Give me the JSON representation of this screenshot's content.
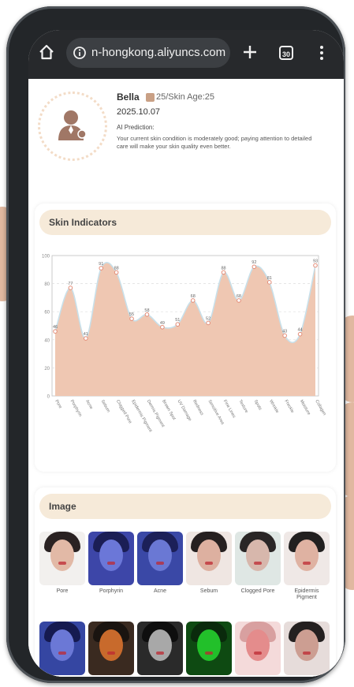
{
  "browser": {
    "url": "n-hongkong.aliyuncs.com",
    "tab_count": "30"
  },
  "profile": {
    "name": "Bella",
    "age_info": "25/Skin Age:25",
    "date": "2025.10.07",
    "ai_label": "AI Prediction:",
    "ai_text": "Your current skin condition is moderately good; paying attention to detailed care will make your skin quality even better."
  },
  "skin_indicators": {
    "title": "Skin Indicators"
  },
  "chart_data": {
    "type": "area",
    "categories": [
      "Pore",
      "Porphyrin",
      "Acne",
      "Sebum",
      "Clogged Pore",
      "Epidermis Pigment",
      "Dermis Pigment",
      "Brown Spot",
      "UV Damage",
      "Redness",
      "Sensitive Area",
      "Fine Lines",
      "Texture",
      "Spots",
      "Wrinkle",
      "Freckle",
      "Moisture",
      "Collagen"
    ],
    "values": [
      46,
      77,
      41,
      91,
      88,
      55,
      58,
      49,
      51,
      68,
      52,
      88,
      68,
      92,
      81,
      43,
      44,
      93
    ],
    "ylim": [
      0,
      100
    ],
    "yticks": [
      "100",
      "80",
      "60",
      "40",
      "20",
      "0"
    ],
    "colors": {
      "fill": "#efc7b2",
      "line": "#c8e0ea",
      "marker": "#e38b76"
    }
  },
  "image": {
    "title": "Image",
    "row1": [
      {
        "label": "Pore",
        "bg": "#f2f0ee",
        "skin": "#e2b9a6",
        "hair": "#2a2222"
      },
      {
        "label": "Porphyrin",
        "bg": "#3d46a8",
        "skin": "#6b77d8",
        "hair": "#1b1e55"
      },
      {
        "label": "Acne",
        "bg": "#3a48a6",
        "skin": "#6a78d4",
        "hair": "#1c2058"
      },
      {
        "label": "Sebum",
        "bg": "#efe6e2",
        "skin": "#ddb0a0",
        "hair": "#262020"
      },
      {
        "label": "Clogged Pore",
        "bg": "#dfe7e4",
        "skin": "#d7b7ac",
        "hair": "#2a2626"
      },
      {
        "label": "Epidermis\nPigment",
        "bg": "#efe8e6",
        "skin": "#dfb2a2",
        "hair": "#222020"
      }
    ],
    "row2": [
      {
        "bg": "#3546a2",
        "skin": "#6b78d6",
        "hair": "#151a50"
      },
      {
        "bg": "#3a2a20",
        "skin": "#c86a2c",
        "hair": "#1a1410"
      },
      {
        "bg": "#2a2a2a",
        "skin": "#a8a8a8",
        "hair": "#0e0e0e"
      },
      {
        "bg": "#0e4a12",
        "skin": "#22c02a",
        "hair": "#0a2a0c"
      },
      {
        "bg": "#f4dada",
        "skin": "#e48c8c",
        "hair": "#d8a0a0"
      },
      {
        "bg": "#e6dcda",
        "skin": "#cc9e92",
        "hair": "#242020"
      }
    ]
  }
}
